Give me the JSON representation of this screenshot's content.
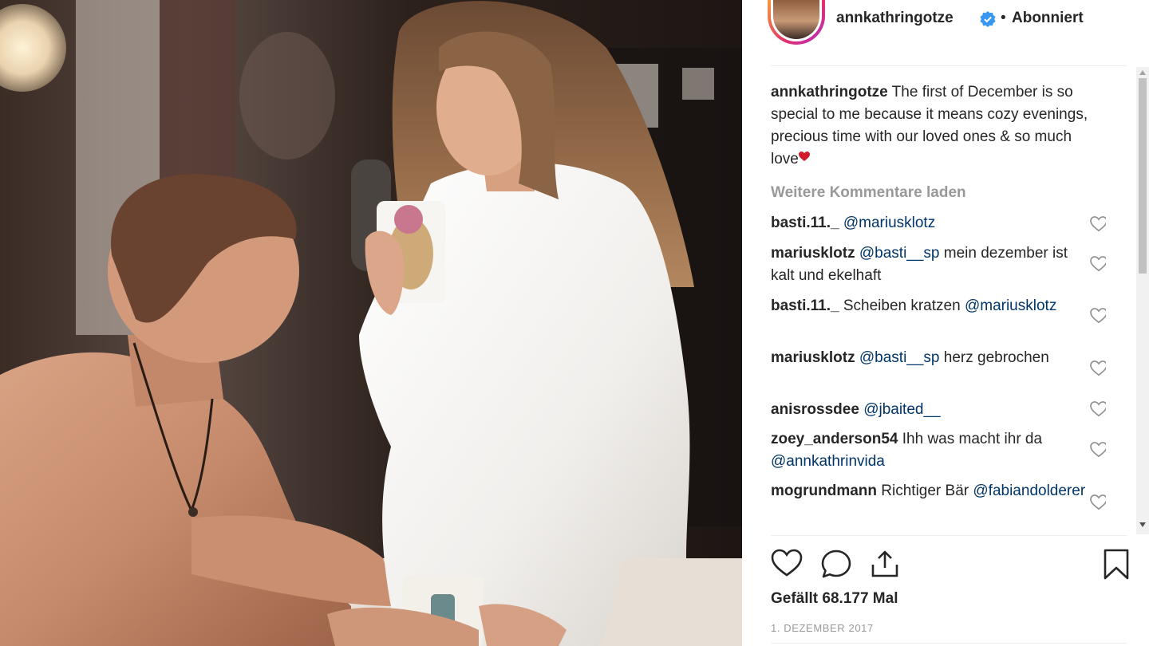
{
  "post": {
    "username": "annkathringotze",
    "follow_state": "Abonniert",
    "separator": "•",
    "caption_user": "annkathringotze",
    "caption_text": "The first of December is so special to me because it means cozy evenings, precious time with our loved ones & so much love",
    "load_more": "Weitere Kommentare laden",
    "likes": "Gefällt 68.177 Mal",
    "date": "1. DEZEMBER 2017"
  },
  "comments": [
    {
      "user": "basti.11._",
      "mention": "@mariusklotz",
      "text": ""
    },
    {
      "user": "mariusklotz",
      "mention": "@basti__sp",
      "text": "mein dezember ist kalt und ekelhaft"
    },
    {
      "user": "basti.11._",
      "mention": "",
      "text": "Scheiben kratzen",
      "mention_after": "@mariusklotz"
    },
    {
      "user": "mariusklotz",
      "mention": "@basti__sp",
      "text": "herz gebrochen"
    },
    {
      "user": "anisrossdee",
      "mention": "@jbaited__",
      "text": ""
    },
    {
      "user": "zoey_anderson54",
      "mention": "",
      "text": "Ihh was macht ihr da",
      "mention_after": "@annkathrinvida"
    },
    {
      "user": "mogrundmann",
      "mention": "",
      "text": "Richtiger Bär",
      "mention_after": "@fabiandolderer"
    }
  ],
  "colors": {
    "link": "#003569",
    "muted": "#999999",
    "text": "#262626",
    "verified": "#3897f0",
    "heart_emoji": "#d11a2a"
  },
  "icons": [
    "verified-badge-icon",
    "heart-outline-icon",
    "comment-icon",
    "share-icon",
    "bookmark-icon"
  ]
}
